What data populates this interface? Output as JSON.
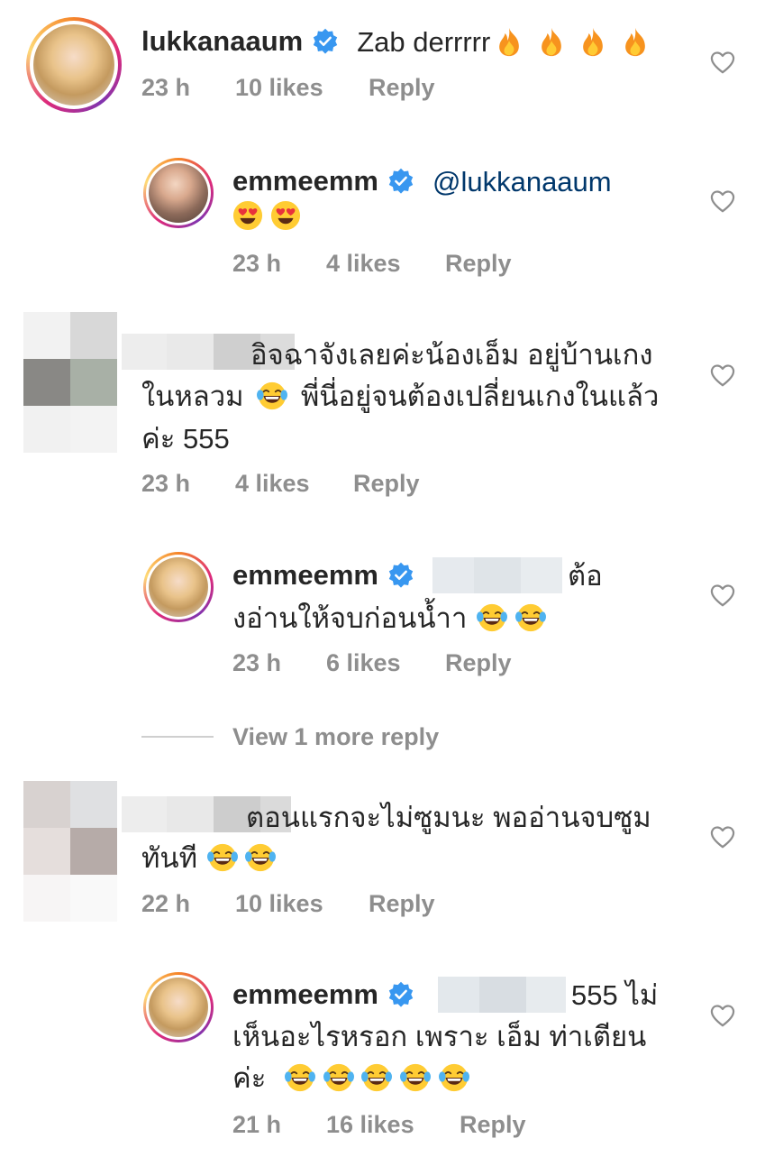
{
  "colors": {
    "text": "#262626",
    "meta": "#8e8e8e",
    "mention": "#00376b",
    "verified": "#3897f0"
  },
  "comments": [
    {
      "username": "lukkanaaum",
      "verified": true,
      "text": "Zab derrrrr",
      "emoji": [
        "fire",
        "fire",
        "fire",
        "fire"
      ],
      "time": "23 h",
      "likes": "10 likes",
      "reply": "Reply"
    },
    {
      "username": "emmeemm",
      "verified": true,
      "mention": "@lukkanaaum",
      "emoji": [
        "heart-eyes",
        "heart-eyes"
      ],
      "time": "23 h",
      "likes": "4 likes",
      "reply": "Reply"
    },
    {
      "username": "",
      "line1": "อิจฉาจังเลยค่ะน้องเอ็ม อยู่บ้านเกง",
      "line2a": "ในหลวม",
      "line2b": "พี่นี่อยู่จนต้องเปลี่ยนเกงในแล้ว",
      "line3": "ค่ะ 555",
      "emoji": [
        "tears-of-joy"
      ],
      "time": "23 h",
      "likes": "4 likes",
      "reply": "Reply"
    },
    {
      "username": "emmeemm",
      "verified": true,
      "line1": "ต้อ",
      "line2": "งอ่านให้จบก่อนน้ำา",
      "emoji": [
        "tears-of-joy",
        "tears-of-joy"
      ],
      "time": "23 h",
      "likes": "6 likes",
      "reply": "Reply"
    },
    {
      "view_more": "View 1 more reply"
    },
    {
      "username": "",
      "line1": "ตอนแรกจะไม่ซูมนะ พออ่านจบซูม",
      "line2": "ทันที",
      "emoji": [
        "tears-of-joy",
        "tears-of-joy"
      ],
      "time": "22 h",
      "likes": "10 likes",
      "reply": "Reply"
    },
    {
      "username": "emmeemm",
      "verified": true,
      "line1": "555 ไม่",
      "line2": "เห็นอะไรหรอก เพราะ เอ็ม ท่าเตียน",
      "line3": "ค่ะ",
      "emoji": [
        "tears-of-joy",
        "tears-of-joy",
        "tears-of-joy",
        "tears-of-joy",
        "tears-of-joy"
      ],
      "time": "21 h",
      "likes": "16 likes",
      "reply": "Reply"
    }
  ]
}
